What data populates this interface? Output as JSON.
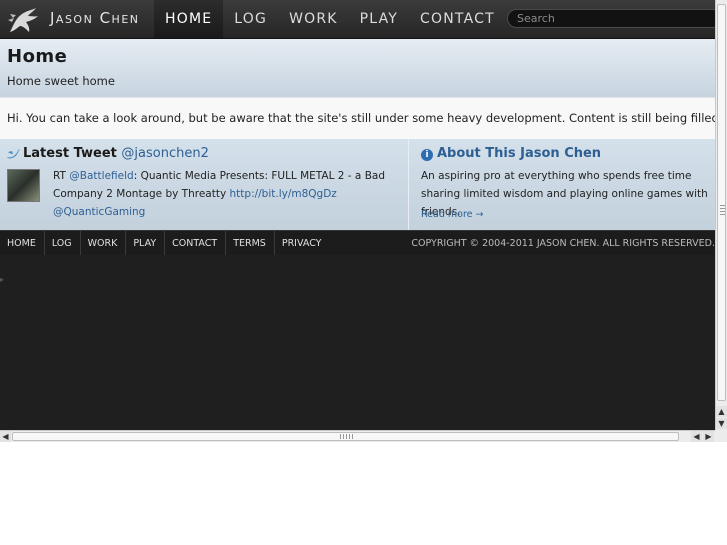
{
  "brand": {
    "name": "Jason Chen",
    "logo_icon": "dragon-icon"
  },
  "nav": {
    "items": [
      "Home",
      "Log",
      "Work",
      "Play",
      "Contact"
    ],
    "active": "Home"
  },
  "search": {
    "placeholder": "Search"
  },
  "page": {
    "title": "Home",
    "subtitle": "Home sweet home"
  },
  "notice": "Hi. You can take a look around, but be aware that the site's still under some heavy development. Content is still being filled in, too.",
  "tweet_section": {
    "heading": "Latest Tweet",
    "handle": "@jasonchen2",
    "icon": "twitter-bird-icon",
    "text_prefix": "RT ",
    "mention": "@Battlefield",
    "text_body": ": Quantic Media Presents: FULL METAL 2 - a Bad Company 2 Montage by Threatty ",
    "link": "http://bit.ly/m8QgDz",
    "mention2": "@QuanticGaming"
  },
  "about_section": {
    "heading": "About This Jason Chen",
    "icon": "info-icon",
    "text": "An aspiring pro at everything who spends free time sharing limited wisdom and playing online games with friends.",
    "read_more": "Read more →"
  },
  "footer": {
    "links": [
      "HOME",
      "LOG",
      "WORK",
      "PLAY",
      "CONTACT",
      "TERMS",
      "PRIVACY"
    ],
    "copyright": "COPYRIGHT © 2004-2011 JASON CHEN. ALL RIGHTS RESERVED."
  },
  "colors": {
    "link": "#2d5f93",
    "topbar": "#2e2e2e",
    "footer": "#1c1c1c"
  }
}
